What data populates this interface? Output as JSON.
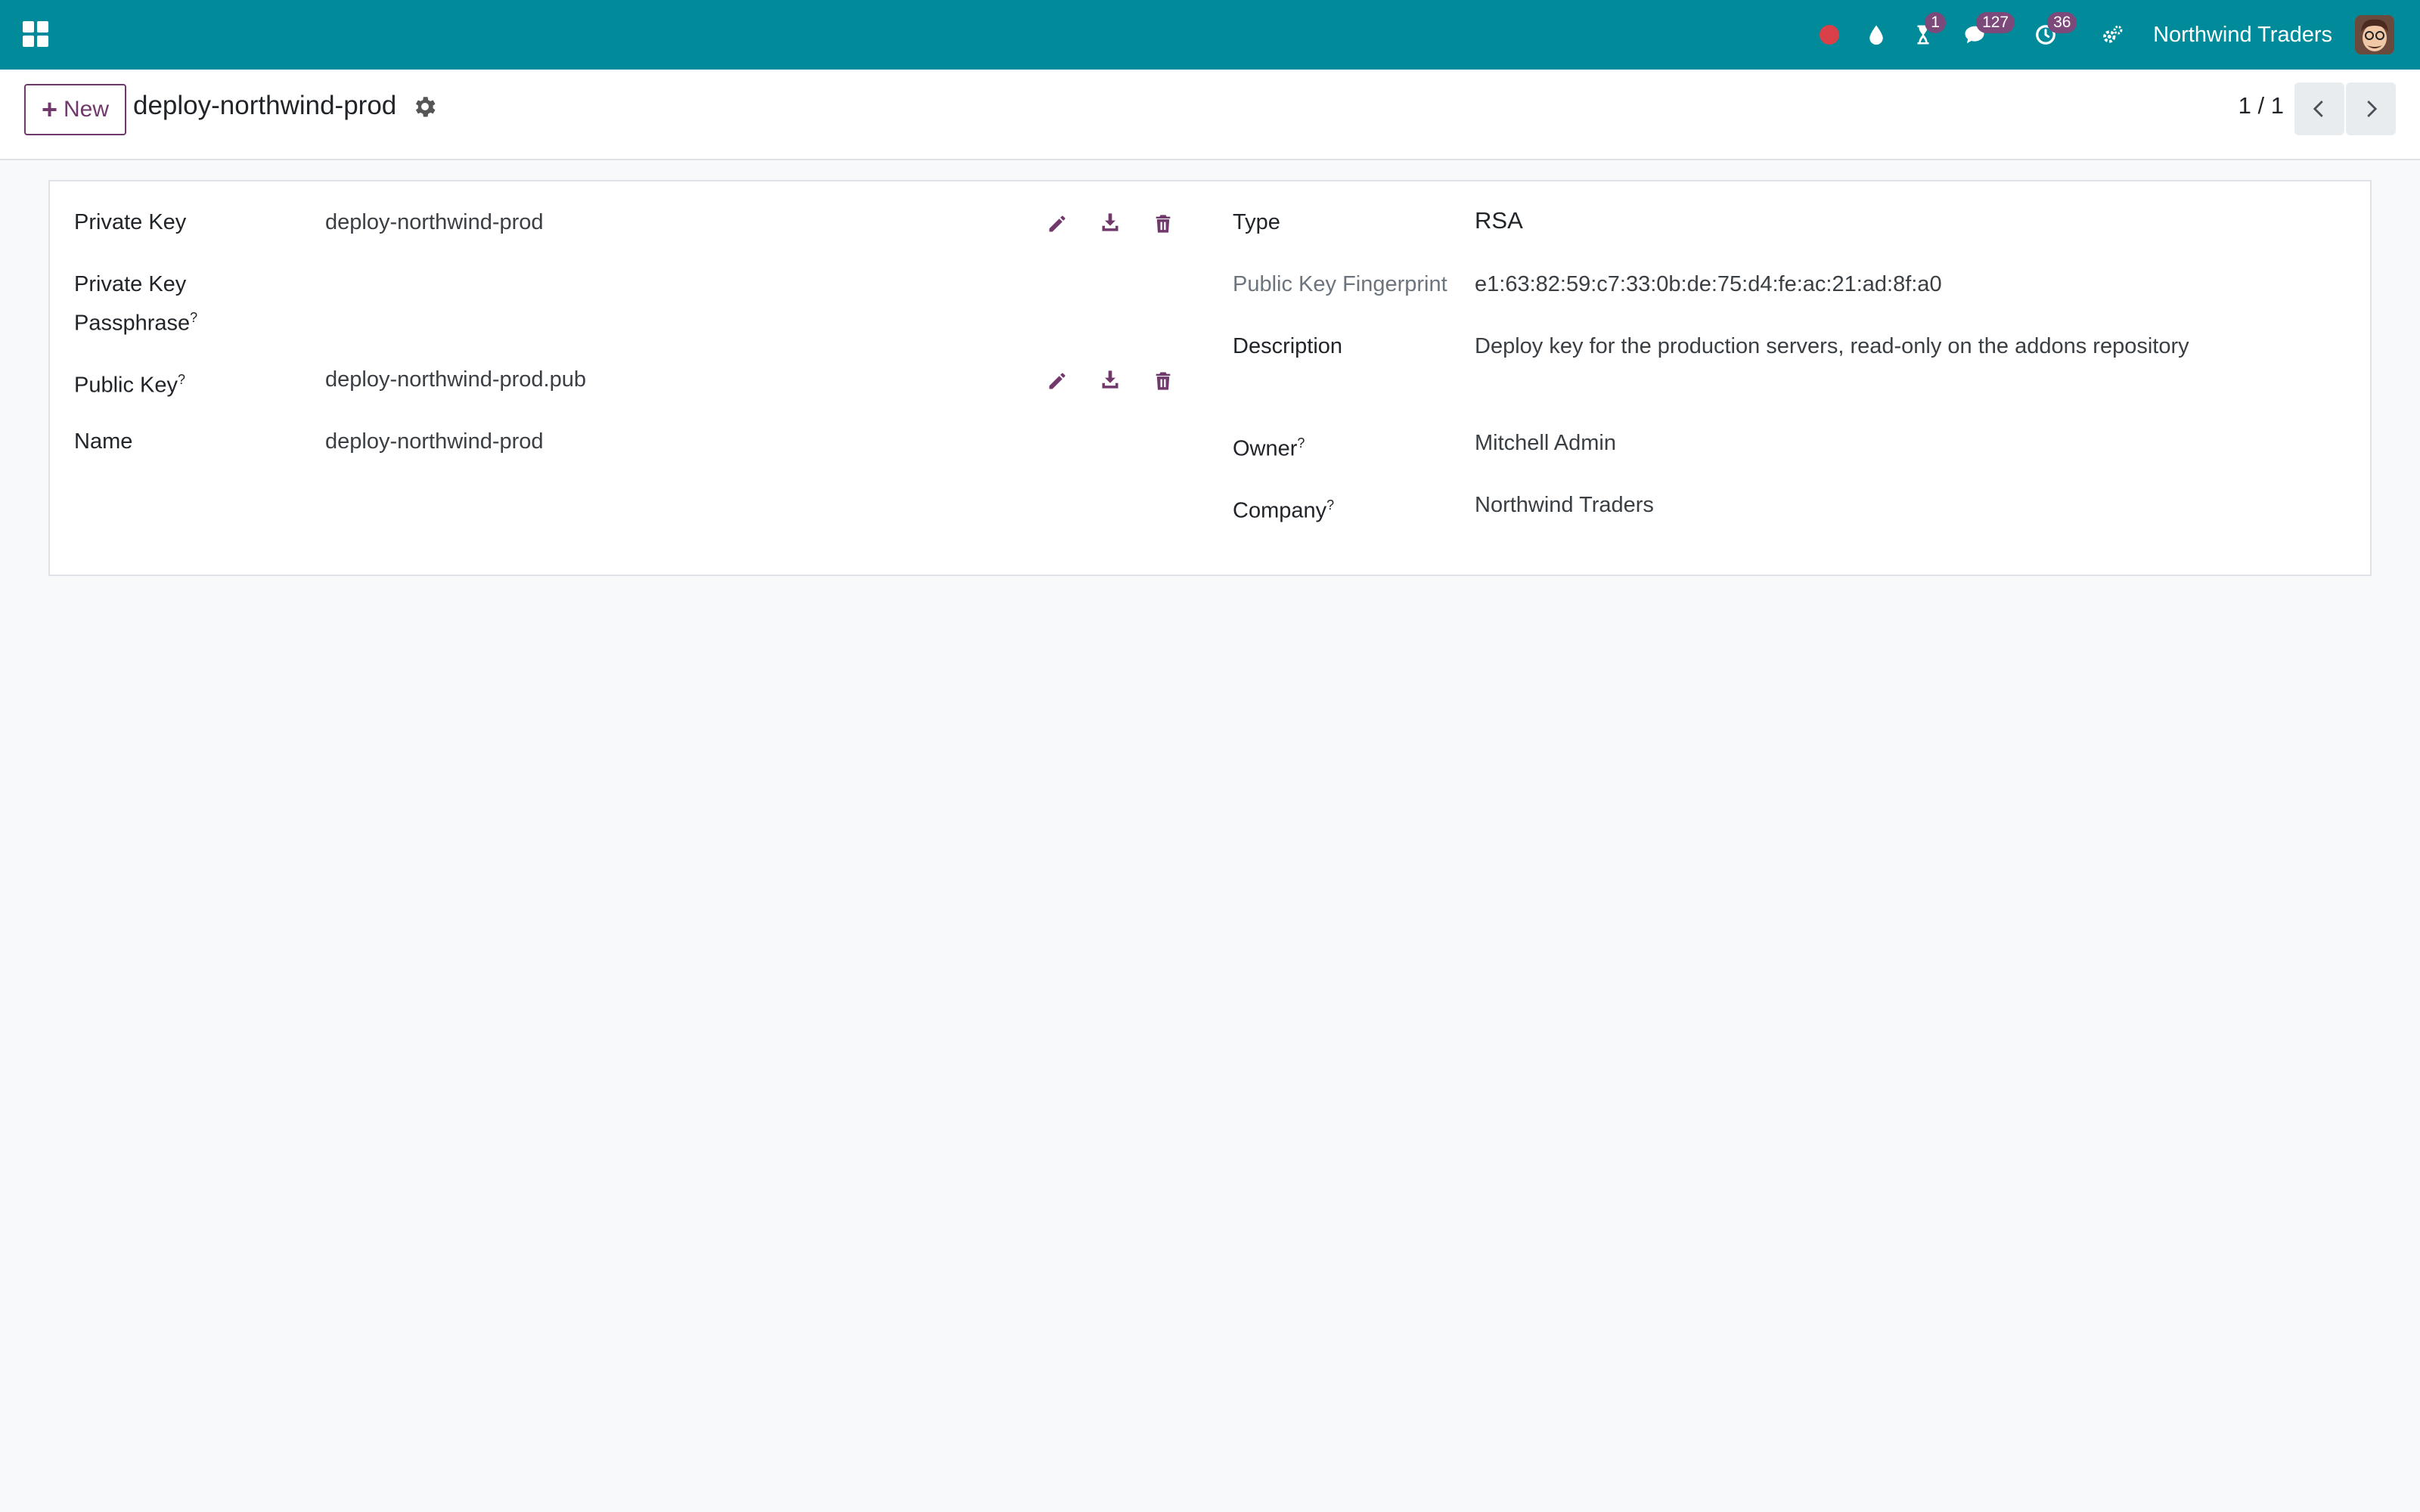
{
  "navbar": {
    "company": "Northwind Traders",
    "activity_badge": "1",
    "messages_badge": "127",
    "clock_badge": "36",
    "colors": {
      "bar": "#018a9a",
      "badge": "#7b4a7b",
      "recording": "#d94048"
    }
  },
  "control": {
    "new_label": "New",
    "record_title": "deploy-northwind-prod",
    "pager": "1 / 1"
  },
  "form": {
    "left": {
      "private_key": {
        "label": "Private Key",
        "value": "deploy-northwind-prod"
      },
      "passphrase": {
        "label_line1": "Private Key",
        "label_line2": "Passphrase",
        "help": "?"
      },
      "public_key": {
        "label": "Public Key",
        "help": "?",
        "value": "deploy-northwind-prod.pub"
      },
      "name": {
        "label": "Name",
        "value": "deploy-northwind-prod"
      }
    },
    "right": {
      "type": {
        "label": "Type",
        "value": "RSA"
      },
      "fingerprint": {
        "label": "Public Key Fingerprint",
        "value": "e1:63:82:59:c7:33:0b:de:75:d4:fe:ac:21:ad:8f:a0"
      },
      "description": {
        "label": "Description",
        "value": "Deploy key for the production servers, read-only on the addons repository"
      },
      "owner": {
        "label": "Owner",
        "help": "?",
        "value": "Mitchell Admin"
      },
      "company": {
        "label": "Company",
        "help": "?",
        "value": "Northwind Traders"
      }
    }
  }
}
